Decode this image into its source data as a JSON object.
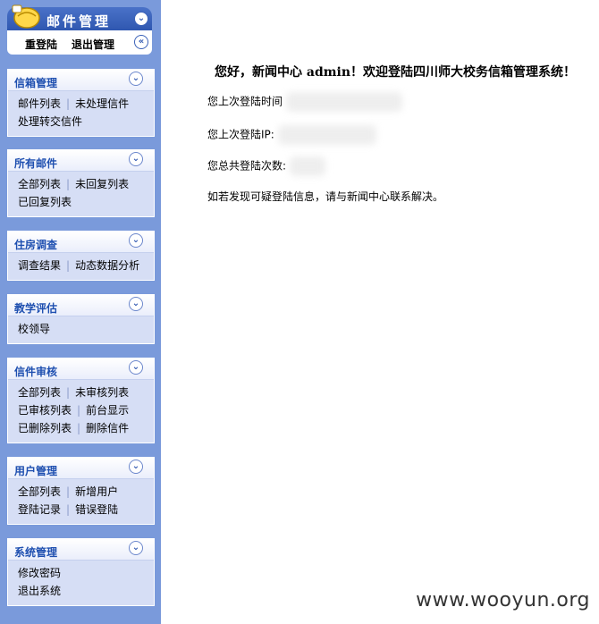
{
  "header": {
    "title": "邮件管理",
    "relogin_label": "重登陆",
    "logout_label": "退出管理"
  },
  "panels": [
    {
      "title": "信箱管理",
      "rows": [
        [
          "邮件列表",
          "未处理信件"
        ],
        [
          "处理转交信件"
        ]
      ]
    },
    {
      "title": "所有邮件",
      "rows": [
        [
          "全部列表",
          "未回复列表"
        ],
        [
          "已回复列表"
        ]
      ]
    },
    {
      "title": "住房调查",
      "rows": [
        [
          "调查结果",
          "动态数据分析"
        ]
      ]
    },
    {
      "title": "教学评估",
      "rows": [
        [
          "校领导"
        ]
      ]
    },
    {
      "title": "信件审核",
      "rows": [
        [
          "全部列表",
          "未审核列表"
        ],
        [
          "已审核列表",
          "前台显示"
        ],
        [
          "已删除列表",
          "删除信件"
        ]
      ]
    },
    {
      "title": "用户管理",
      "rows": [
        [
          "全部列表",
          "新增用户"
        ],
        [
          "登陆记录",
          "错误登陆"
        ]
      ]
    },
    {
      "title": "系统管理",
      "rows": [
        [
          "修改密码"
        ],
        [
          "退出系统"
        ]
      ]
    }
  ],
  "main": {
    "welcome": "您好，新闻中心 admin！欢迎登陆四川师大校务信箱管理系统！",
    "last_login_time_label": "您上次登陆时间",
    "last_login_ip_label": "您上次登陆IP:",
    "login_count_label": "您总共登陆次数:",
    "notice": "如若发现可疑登陆信息，请与新闻中心联系解决。"
  },
  "watermark": "www.wooyun.org",
  "colors": {
    "sidebar_bg": "#7a9adb",
    "panel_title": "#1e4fb0",
    "panel_bg": "#d6def5"
  }
}
